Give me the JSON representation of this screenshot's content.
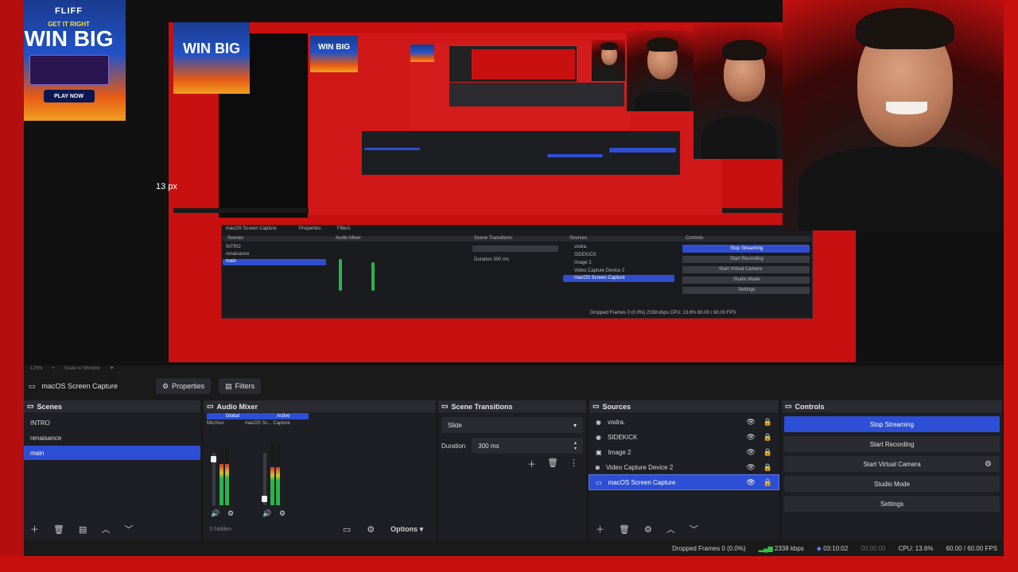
{
  "preview": {
    "ad_brand": "FLIFF",
    "ad_tagline": "GET IT RIGHT",
    "ad_headline": "WIN BIG",
    "ad_cta": "PLAY NOW",
    "px_label": "13 px"
  },
  "zoom_strip": {
    "zoom": "125%",
    "plus": "+",
    "scale": "Scale to Window"
  },
  "source_toolbar": {
    "source_name": "macOS Screen Capture",
    "properties": "Properties",
    "filters": "Filters"
  },
  "scenes": {
    "title": "Scenes",
    "items": [
      "INTRO",
      "renaisance",
      "main"
    ],
    "active_index": 2
  },
  "mixer": {
    "title": "Audio Mixer",
    "tab_global": "Global",
    "tab_active": "Active",
    "channels": [
      {
        "name": "Mic/Aux",
        "level": 0.72
      },
      {
        "name": "macOS Sc... Capture",
        "level": 0.6
      }
    ],
    "footer_label": "0 hidden",
    "options": "Options"
  },
  "transitions": {
    "title": "Scene Transitions",
    "selected": "Slide",
    "duration_label": "Duration",
    "duration_value": "300 ms"
  },
  "sources": {
    "title": "Sources",
    "items": [
      "vodra.",
      "SIDEKICK",
      "Image 2",
      "Video Capture Device 2",
      "macOS Screen Capture"
    ],
    "active_index": 4
  },
  "controls": {
    "title": "Controls",
    "stop_streaming": "Stop Streaming",
    "start_recording": "Start Recording",
    "start_virtual_camera": "Start Virtual Camera",
    "studio_mode": "Studio Mode",
    "settings": "Settings"
  },
  "status": {
    "dropped_frames": "Dropped Frames 0 (0.0%)",
    "bitrate": "2338 kbps",
    "stream_time": "03:10:02",
    "rec_time": "00:00:00",
    "cpu": "CPU: 13.6%",
    "fps": "60.00 / 60.00 FPS"
  },
  "colors": {
    "accent": "#2d4fd6",
    "frame_red": "#c81010",
    "dock_bg": "#1e1f24"
  }
}
